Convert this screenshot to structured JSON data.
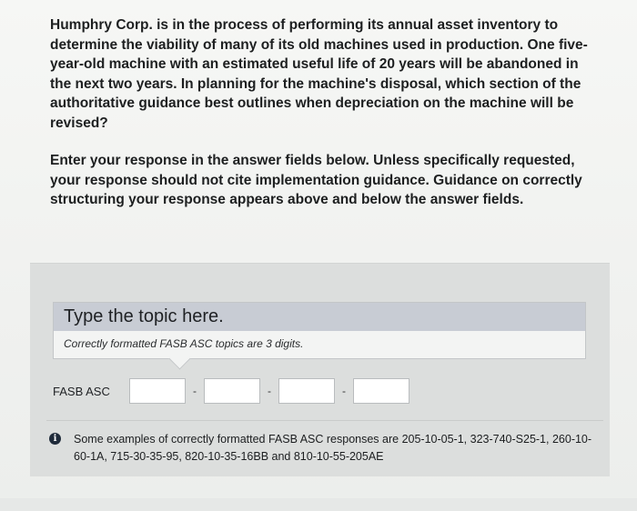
{
  "question": {
    "paragraph1": "Humphry Corp. is in the process of performing its annual asset inventory to determine the viability of many of its old machines used in production. One five-year-old machine with an estimated useful life of 20 years will be abandoned in the next two years. In planning for the machine's disposal, which section of the authoritative guidance best outlines when depreciation on the machine will be revised?",
    "paragraph2": "Enter your response in the answer fields below. Unless specifically requested, your response should not cite implementation guidance. Guidance on correctly structuring your response appears above and below the answer fields."
  },
  "hint": {
    "title": "Type the topic here.",
    "subtitle": "Correctly formatted FASB ASC topics are 3 digits."
  },
  "fasb": {
    "label": "FASB ASC",
    "separator": "-",
    "fields": [
      "",
      "",
      "",
      ""
    ]
  },
  "info": {
    "icon": "info-icon",
    "text": "Some examples of correctly formatted FASB ASC responses are 205-10-05-1, 323-740-S25-1, 260-10-60-1A, 715-30-35-95, 820-10-35-16BB and 810-10-55-205AE"
  }
}
